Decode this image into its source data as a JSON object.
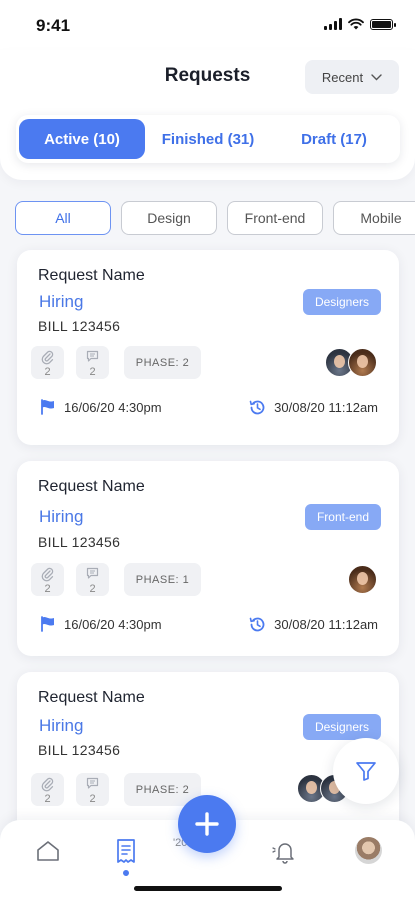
{
  "status_bar": {
    "time": "9:41"
  },
  "header": {
    "title": "Requests",
    "sort": {
      "selected": "Recent"
    }
  },
  "tabs": [
    {
      "label": "Active (10)",
      "active": true
    },
    {
      "label": "Finished (31)",
      "active": false
    },
    {
      "label": "Draft (17)",
      "active": false
    }
  ],
  "filters": [
    {
      "label": "All",
      "active": true
    },
    {
      "label": "Design",
      "active": false
    },
    {
      "label": "Front-end",
      "active": false
    },
    {
      "label": "Mobile",
      "active": false
    }
  ],
  "cards": [
    {
      "title": "Request Name",
      "subtitle": "Hiring",
      "id": "BILL  123456",
      "tag": "Designers",
      "attachments": "2",
      "comments": "2",
      "phase": "PHASE: 2",
      "start": "16/06/20 4:30pm",
      "due": "30/08/20 11:12am"
    },
    {
      "title": "Request Name",
      "subtitle": "Hiring",
      "id": "BILL  123456",
      "tag": "Front-end",
      "attachments": "2",
      "comments": "2",
      "phase": "PHASE: 1",
      "start": "16/06/20 4:30pm",
      "due": "30/08/20 11:12am"
    },
    {
      "title": "Request Name",
      "subtitle": "Hiring",
      "id": "BILL  123456",
      "tag": "Designers",
      "attachments": "2",
      "comments": "2",
      "phase": "PHASE: 2"
    }
  ],
  "nav": {
    "stray_text": "'20"
  },
  "colors": {
    "accent": "#4b7af0",
    "tag": "#87a9f5",
    "link": "#4a78e6",
    "background": "#f5f6f9"
  }
}
